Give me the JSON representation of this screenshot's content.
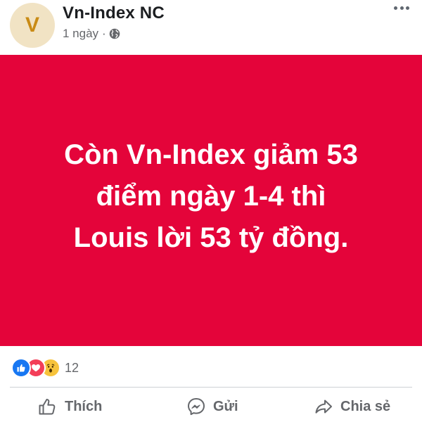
{
  "post": {
    "page_name": "Vn-Index NC",
    "avatar_letter": "V",
    "time": "1 ngày",
    "separator": "·",
    "privacy_icon": "globe-icon",
    "more_icon": "more-options-icon"
  },
  "card": {
    "background_color": "#e4043a",
    "text_color": "#ffffff",
    "lines": [
      "Còn Vn-Index giảm 53",
      "điểm ngày 1-4 thì",
      "Louis lời 53 tỷ đồng."
    ]
  },
  "reactions": {
    "icons": [
      "like-reaction-icon",
      "love-reaction-icon",
      "wow-reaction-icon"
    ],
    "count": "12"
  },
  "actions": {
    "like_label": "Thích",
    "send_label": "Gửi",
    "share_label": "Chia sẻ"
  }
}
